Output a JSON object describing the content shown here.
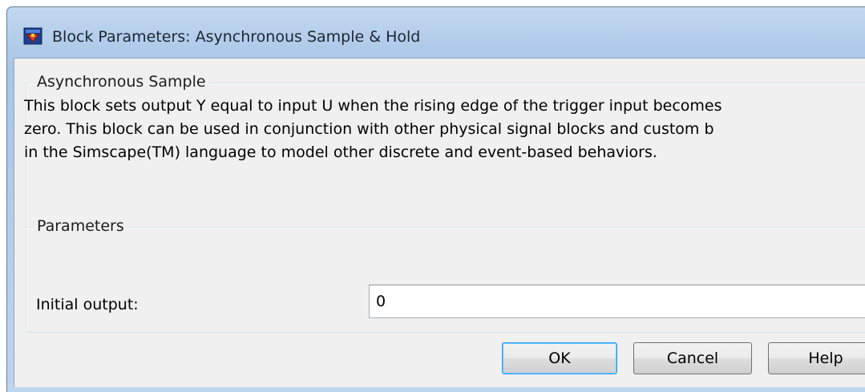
{
  "window": {
    "title": "Block Parameters: Asynchronous Sample & Hold",
    "icon": "simulink-block-icon"
  },
  "description_group": {
    "legend": "Asynchronous Sample",
    "lines": [
      "This block sets output Y equal to input U when the rising edge of the trigger input becomes",
      "zero. This block can be used in conjunction with other physical signal blocks and custom b",
      "in the Simscape(TM) language to model other discrete and event-based behaviors."
    ]
  },
  "parameters_group": {
    "legend": "Parameters",
    "initial_output_label": "Initial output:",
    "initial_output_value": "0"
  },
  "buttons": {
    "ok": "OK",
    "cancel": "Cancel",
    "help": "Help"
  }
}
